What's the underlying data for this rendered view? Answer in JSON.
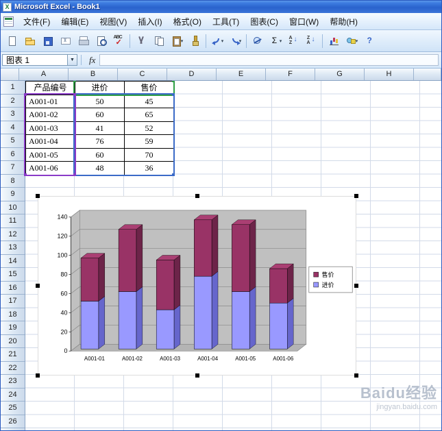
{
  "window": {
    "title": "Microsoft Excel - Book1"
  },
  "menu": {
    "items": [
      "文件(F)",
      "编辑(E)",
      "视图(V)",
      "插入(I)",
      "格式(O)",
      "工具(T)",
      "图表(C)",
      "窗口(W)",
      "帮助(H)"
    ]
  },
  "toolbar": {
    "items": [
      {
        "name": "new"
      },
      {
        "name": "open"
      },
      {
        "name": "save"
      },
      {
        "name": "email"
      },
      {
        "name": "print"
      },
      {
        "name": "print-preview"
      },
      {
        "name": "spelling"
      },
      {
        "separator": true
      },
      {
        "name": "cut"
      },
      {
        "name": "copy"
      },
      {
        "name": "paste",
        "dropdown": true
      },
      {
        "name": "format-painter"
      },
      {
        "separator": true
      },
      {
        "name": "undo",
        "dropdown": true
      },
      {
        "name": "redo",
        "dropdown": true
      },
      {
        "separator": true
      },
      {
        "name": "hyperlink"
      },
      {
        "name": "autosum",
        "dropdown": true
      },
      {
        "name": "sort-ascending"
      },
      {
        "name": "sort-descending"
      },
      {
        "separator": true
      },
      {
        "name": "chart-wizard"
      },
      {
        "name": "drawing",
        "dropdown": true
      },
      {
        "name": "help"
      }
    ]
  },
  "formula_bar": {
    "name_box": "图表 1",
    "fx_label": "fx",
    "formula": ""
  },
  "grid": {
    "columns": [
      "A",
      "B",
      "C",
      "D",
      "E",
      "F",
      "G",
      "H"
    ],
    "row_count": 26,
    "table": {
      "start_cell": "A1",
      "headers": [
        "产品编号",
        "进价",
        "售价"
      ],
      "rows": [
        [
          "A001-01",
          "50",
          "45"
        ],
        [
          "A001-02",
          "60",
          "65"
        ],
        [
          "A001-03",
          "41",
          "52"
        ],
        [
          "A001-04",
          "76",
          "59"
        ],
        [
          "A001-05",
          "60",
          "70"
        ],
        [
          "A001-06",
          "48",
          "36"
        ]
      ],
      "range_outline_colors": {
        "series_names": "#2e9e44",
        "values": "#3a6ac8",
        "categories": "#8a3ac8"
      }
    }
  },
  "chart_data": {
    "type": "bar",
    "subtype": "3d-stacked-column",
    "categories": [
      "A001-01",
      "A001-02",
      "A001-03",
      "A001-04",
      "A001-05",
      "A001-06"
    ],
    "series": [
      {
        "name": "进价",
        "values": [
          50,
          60,
          41,
          76,
          60,
          48
        ],
        "color": "#9999ff",
        "side_color": "#6666cc"
      },
      {
        "name": "售价",
        "values": [
          45,
          65,
          52,
          59,
          70,
          36
        ],
        "color": "#993366",
        "side_color": "#6d2449",
        "top_color": "#aa3f73"
      }
    ],
    "title": "",
    "xlabel": "",
    "ylabel": "",
    "ylim": [
      0,
      140
    ],
    "ytick_step": 20,
    "grid_on": true,
    "wall_color": "#c0c0c0",
    "floor_color": "#b4b4b4",
    "legend": {
      "position": "right",
      "entries": [
        "售价",
        "进价"
      ]
    }
  },
  "watermark": {
    "title": "Baidu经验",
    "subtitle": "jingyan.baidu.com"
  }
}
